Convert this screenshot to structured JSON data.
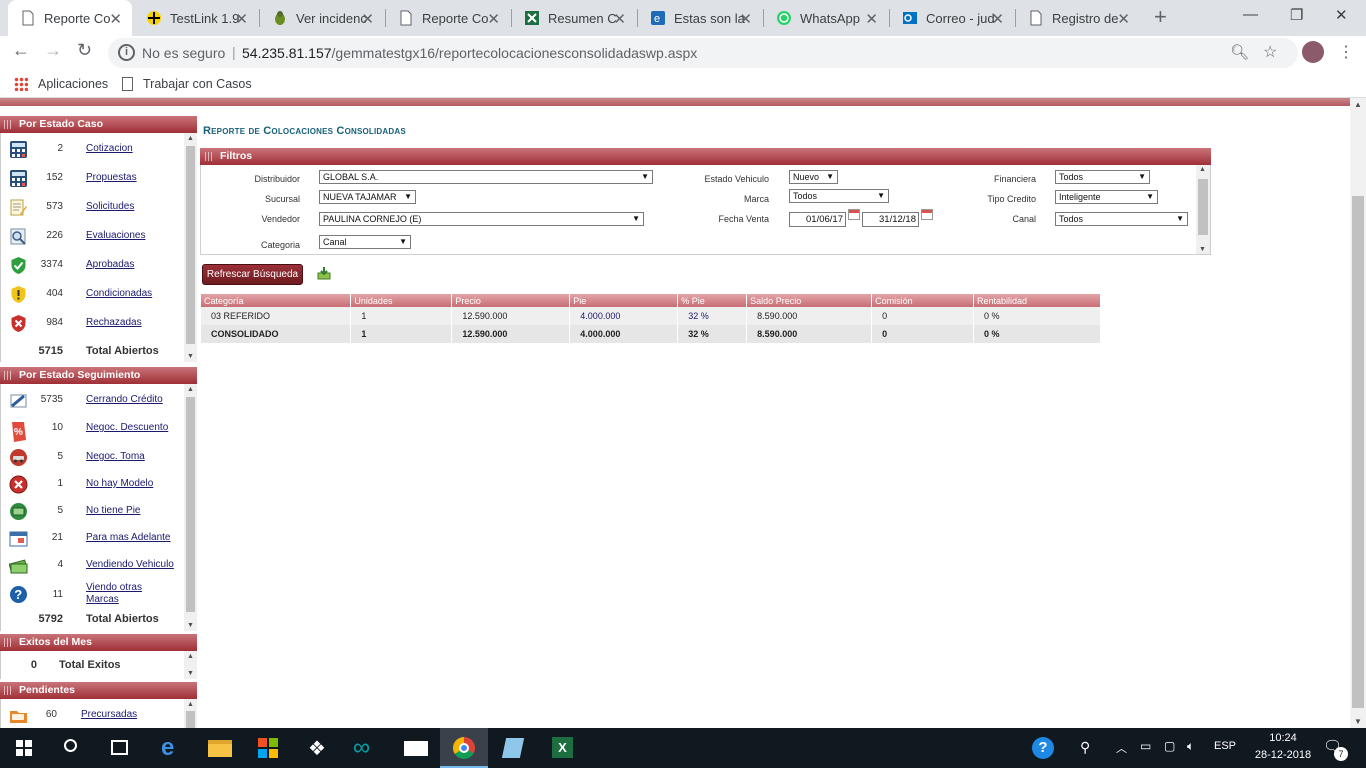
{
  "browser": {
    "tabs": [
      {
        "label": "Reporte Co",
        "icon": "document-icon",
        "active": true
      },
      {
        "label": "TestLink 1.9",
        "icon": "testlink-icon"
      },
      {
        "label": "Ver incidenc",
        "icon": "bug-icon"
      },
      {
        "label": "Reporte Co",
        "icon": "document-icon"
      },
      {
        "label": "Resumen C",
        "icon": "excel-icon"
      },
      {
        "label": "Estas son la",
        "icon": "ie-icon"
      },
      {
        "label": "WhatsApp",
        "icon": "whatsapp-icon"
      },
      {
        "label": "Correo - jud",
        "icon": "outlook-icon"
      },
      {
        "label": "Registro de",
        "icon": "document-icon"
      }
    ],
    "security_text": "No es seguro",
    "url_host": "54.235.81.157",
    "url_path": "/gemmatestgx16/reportecolocacionesconsolidadaswp.aspx",
    "bookmarks": [
      {
        "label": "Aplicaciones",
        "icon": "apps-grid-icon"
      },
      {
        "label": "Trabajar con Casos",
        "icon": "page-icon"
      }
    ]
  },
  "sidebar": {
    "estado_caso": {
      "title": "Por Estado Caso",
      "items": [
        {
          "count": "2",
          "label": "Cotizacion",
          "icon": "calculator-icon"
        },
        {
          "count": "152",
          "label": "Propuestas",
          "icon": "calculator-icon"
        },
        {
          "count": "573",
          "label": "Solicitudes",
          "icon": "form-pencil-icon"
        },
        {
          "count": "226",
          "label": "Evaluaciones",
          "icon": "magnifier-doc-icon"
        },
        {
          "count": "3374",
          "label": "Aprobadas",
          "icon": "green-shield-check-icon"
        },
        {
          "count": "404",
          "label": "Condicionadas",
          "icon": "yellow-shield-warning-icon"
        },
        {
          "count": "984",
          "label": "Rechazadas",
          "icon": "red-shield-x-icon"
        }
      ],
      "total_count": "5715",
      "total_label": "Total Abiertos"
    },
    "estado_seguimiento": {
      "title": "Por Estado Seguimiento",
      "items": [
        {
          "count": "5735",
          "label": "Cerrando Crédito",
          "icon": "writing-hand-icon"
        },
        {
          "count": "10",
          "label": "Negoc. Descuento",
          "icon": "percent-tag-icon"
        },
        {
          "count": "5",
          "label": "Negoc. Toma",
          "icon": "car-trade-icon"
        },
        {
          "count": "1",
          "label": "No hay Modelo",
          "icon": "red-x-circle-icon"
        },
        {
          "count": "5",
          "label": "No tiene Pie",
          "icon": "money-stack-icon"
        },
        {
          "count": "21",
          "label": "Para mas Adelante",
          "icon": "calendar-icon"
        },
        {
          "count": "4",
          "label": "Vendiendo Vehiculo",
          "icon": "cash-bills-icon"
        },
        {
          "count": "11",
          "label": "Viendo otras Marcas",
          "icon": "question-circle-icon"
        }
      ],
      "total_count": "5792",
      "total_label": "Total Abiertos"
    },
    "exitos": {
      "title": "Exitos del Mes",
      "total_count": "0",
      "total_label": "Total Exitos"
    },
    "pendientes": {
      "title": "Pendientes",
      "items": [
        {
          "count": "60",
          "label": "Precursadas",
          "icon": "orange-folder-icon"
        }
      ]
    }
  },
  "report": {
    "title": "Reporte de Colocaciones Consolidadas",
    "filters_title": "Filtros",
    "filters": {
      "distribuidor": {
        "label": "Distribuidor",
        "value": "GLOBAL S.A."
      },
      "sucursal": {
        "label": "Sucursal",
        "value": "NUEVA TAJAMAR"
      },
      "vendedor": {
        "label": "Vendedor",
        "value": "PAULINA CORNEJO (E)"
      },
      "categoria": {
        "label": "Categoria",
        "value": "Canal"
      },
      "estado_vehiculo": {
        "label": "Estado Vehiculo",
        "value": "Nuevo"
      },
      "marca": {
        "label": "Marca",
        "value": "Todos"
      },
      "fecha_venta": {
        "label": "Fecha Venta",
        "from": "01/06/17",
        "to": "31/12/18"
      },
      "financiera": {
        "label": "Financiera",
        "value": "Todos"
      },
      "tipo_credito": {
        "label": "Tipo Credito",
        "value": "Inteligente"
      },
      "canal": {
        "label": "Canal",
        "value": "Todos"
      }
    },
    "refresh_label": "Refrescar Búsqueda",
    "table": {
      "headers": [
        "Categoría",
        "Unidades",
        "Precio",
        "Pie",
        "% Pie",
        "Saldo Precio",
        "Comisión",
        "Rentabilidad"
      ],
      "rows": [
        [
          "03 REFERIDO",
          "1",
          "12.590.000",
          "4.000.000",
          "32 %",
          "8.590.000",
          "0",
          "0 %"
        ],
        [
          "CONSOLIDADO",
          "1",
          "12.590.000",
          "4.000.000",
          "32 %",
          "8.590.000",
          "0",
          "0 %"
        ]
      ]
    }
  },
  "taskbar": {
    "apps": [
      "start-icon",
      "search-icon",
      "task-view-icon",
      "edge-icon",
      "file-explorer-icon",
      "store-icon",
      "dropbox-icon",
      "arduino-icon",
      "mail-icon",
      "chrome-icon",
      "notes-icon",
      "excel-icon"
    ],
    "language": "ESP",
    "time": "10:24",
    "date": "28-12-2018",
    "notifications": "7"
  },
  "colors": {
    "accent": "#9f2f36",
    "title_teal": "#17607a",
    "link": "#1a1a6e"
  }
}
